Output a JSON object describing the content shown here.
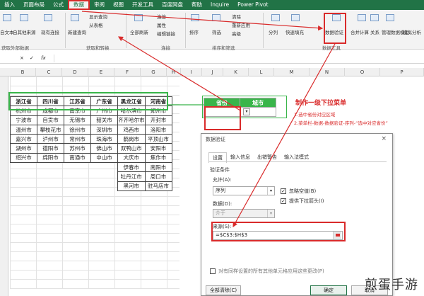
{
  "ribbon_tabs": [
    "插入",
    "页面布局",
    "公式",
    "数据",
    "审阅",
    "视图",
    "开发工具",
    "百度网盘",
    "帮助",
    "Inquire",
    "Power Pivot"
  ],
  "ribbon_items": {
    "from_text": "自文本",
    "from_other": "自其他来源",
    "existing_conn": "现有连接",
    "new_query": "新建查询",
    "show_query": "显示查询",
    "from_table": "从表格",
    "refresh_all": "全部刷新",
    "connections": "连接",
    "properties": "属性",
    "edit_links": "编辑链接",
    "sort": "排序",
    "filter": "筛选",
    "clear": "清除",
    "reapply": "重新应用",
    "advanced": "高级",
    "split": "分列",
    "flash_fill": "快速填充",
    "data_validation": "数据验证",
    "consolidate": "合并计算",
    "relationships": "关系",
    "data_model": "管理数据模型",
    "what_if": "模拟分析",
    "group_external": "获取外部数据",
    "group_transform": "获取和转换",
    "group_connections": "连接",
    "group_sort": "排序和筛选",
    "group_tools": "数据工具"
  },
  "formula_bar": {
    "fx": "fx",
    "x_btn": "×",
    "check_btn": "✓"
  },
  "columns_left": [
    "B",
    "C",
    "D",
    "E",
    "F",
    "G",
    "H",
    "I"
  ],
  "columns_right": [
    "J",
    "K",
    "L",
    "M",
    "N",
    "O",
    "P"
  ],
  "city_table": {
    "headers": [
      "浙江省",
      "四川省",
      "江苏省",
      "广东省",
      "黑龙江省",
      "河南省"
    ],
    "rows": [
      [
        "杭州市",
        "成都市",
        "南京市",
        "广州市",
        "哈尔滨市",
        "郑州市"
      ],
      [
        "宁波市",
        "自贡市",
        "无锡市",
        "韶关市",
        "齐齐哈尔市",
        "开封市"
      ],
      [
        "温州市",
        "攀枝花市",
        "徐州市",
        "深圳市",
        "鸡西市",
        "洛阳市"
      ],
      [
        "嘉兴市",
        "泸州市",
        "常州市",
        "珠海市",
        "鹤岗市",
        "平顶山市"
      ],
      [
        "湖州市",
        "德阳市",
        "苏州市",
        "佛山市",
        "双鸭山市",
        "安阳市"
      ],
      [
        "绍兴市",
        "绵阳市",
        "南通市",
        "中山市",
        "大庆市",
        "焦作市"
      ],
      [
        "",
        "",
        "",
        "",
        "伊春市",
        "南阳市"
      ],
      [
        "",
        "",
        "",
        "",
        "牡丹江市",
        "周口市"
      ],
      [
        "",
        "",
        "",
        "",
        "黑河市",
        "驻马店市"
      ]
    ]
  },
  "kl_table": {
    "province_header": "省份",
    "city_header": "城市"
  },
  "annotation": {
    "title": "制作一级下拉菜单",
    "step1": "1.选中省份对应区域",
    "step2": "2.菜单栏-数据-数据验证-序列-“选中对应省份”"
  },
  "dialog": {
    "title": "数据验证",
    "close": "×",
    "tabs": [
      "设置",
      "输入信息",
      "出错警告",
      "输入法模式"
    ],
    "criteria_label": "验证条件",
    "allow_label": "允许(A):",
    "allow_value": "序列",
    "ignore_blank": "忽略空值(B)",
    "dropdown": "提供下拉箭头(I)",
    "data_label": "数据(D):",
    "data_value": "介于",
    "source_label": "来源(S):",
    "source_value": "=$C$3:$H$3",
    "apply_all": "对有同样设置的所有其他单元格应用这些更改(P)",
    "clear_all": "全部清除(C)",
    "ok": "确定",
    "cancel": "取消"
  },
  "watermark": "煎蛋手游",
  "colors": {
    "excel_green": "#217346",
    "red": "#d92b2b",
    "table_green": "#39b54a"
  }
}
